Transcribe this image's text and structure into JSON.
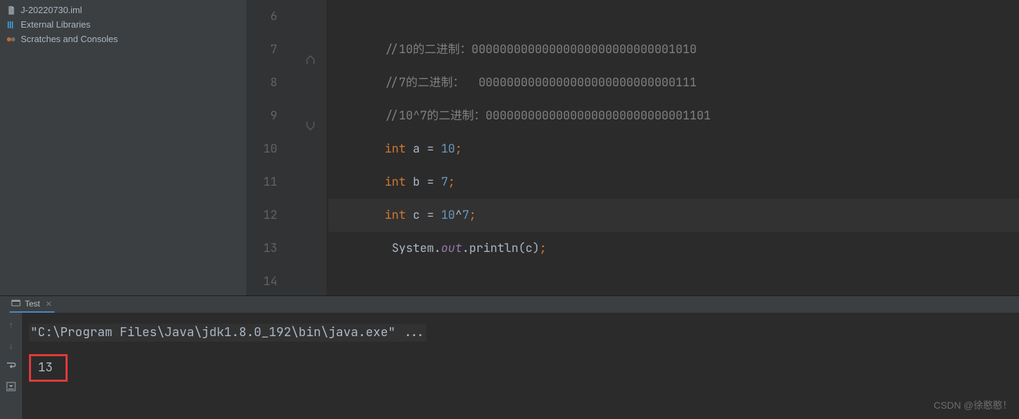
{
  "sidebar": {
    "items": [
      {
        "label": "J-20220730.iml",
        "kind": "file"
      },
      {
        "label": "External Libraries",
        "kind": "lib"
      },
      {
        "label": "Scratches and Consoles",
        "kind": "scratch"
      }
    ]
  },
  "editor": {
    "lines": [
      {
        "num": "6",
        "type": "blank"
      },
      {
        "num": "7",
        "type": "comment",
        "text": "//10的二进制：00000000000000000000000000001010",
        "fold": "up"
      },
      {
        "num": "8",
        "type": "comment",
        "text": "//7的二进制：  0000000000000000000000000000111"
      },
      {
        "num": "9",
        "type": "comment",
        "text": "//10^7的二进制：00000000000000000000000000001101",
        "fold": "down"
      },
      {
        "num": "10",
        "type": "decl",
        "kw": "int",
        "var": "a",
        "val": "10"
      },
      {
        "num": "11",
        "type": "decl",
        "kw": "int",
        "var": "b",
        "val": "7"
      },
      {
        "num": "12",
        "type": "xor",
        "kw": "int",
        "var": "c",
        "l": "10",
        "r": "7",
        "hl": true
      },
      {
        "num": "13",
        "type": "println",
        "obj": "System",
        "field": "out",
        "method": "println",
        "arg": "c"
      },
      {
        "num": "14",
        "type": "blank"
      }
    ]
  },
  "run": {
    "tab_name": "Test",
    "cmd": "\"C:\\Program Files\\Java\\jdk1.8.0_192\\bin\\java.exe\" ...",
    "output": "13"
  },
  "watermark": "CSDN @徐憨憨！"
}
